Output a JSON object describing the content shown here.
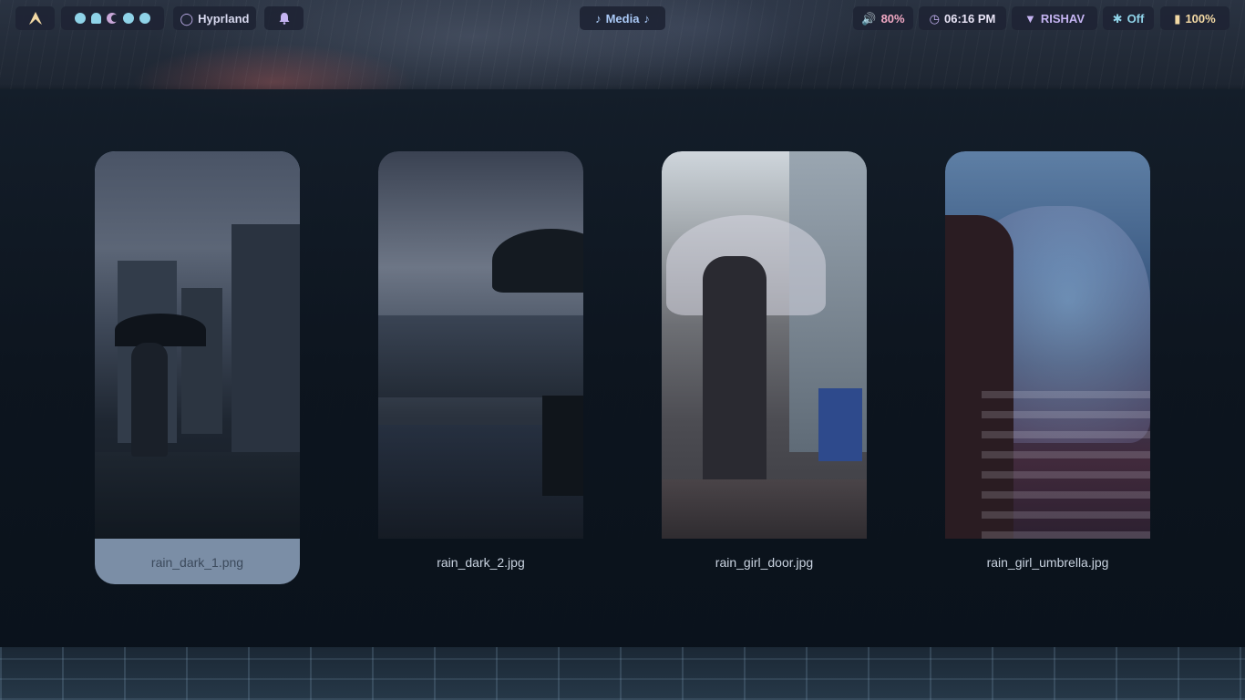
{
  "topbar": {
    "workspace_label": "Hyprland",
    "media_label": "Media",
    "volume": "80%",
    "clock": "06:16 PM",
    "user": "RISHAV",
    "bluetooth": "Off",
    "battery": "100%"
  },
  "wallpapers": [
    {
      "filename": "rain_dark_1.png",
      "selected": true
    },
    {
      "filename": "rain_dark_2.jpg",
      "selected": false
    },
    {
      "filename": "rain_girl_door.jpg",
      "selected": false
    },
    {
      "filename": "rain_girl_umbrella.jpg",
      "selected": false
    }
  ],
  "icons": {
    "launcher": "arch-logo-icon",
    "workspaces": "workspace-dots",
    "hyprland": "droplet-icon",
    "notifications": "bell-icon",
    "media": "music-note-icon",
    "volume": "speaker-icon",
    "clock": "clock-icon",
    "user": "diamond-icon",
    "bluetooth": "bluetooth-icon",
    "battery": "battery-icon"
  },
  "colors": {
    "bar_bg": "#1e2434",
    "accent_cyan": "#8fd3e8",
    "accent_pink": "#f2a9c4",
    "accent_lavender": "#c5b4f2",
    "selected_card": "#7b8ea6"
  }
}
